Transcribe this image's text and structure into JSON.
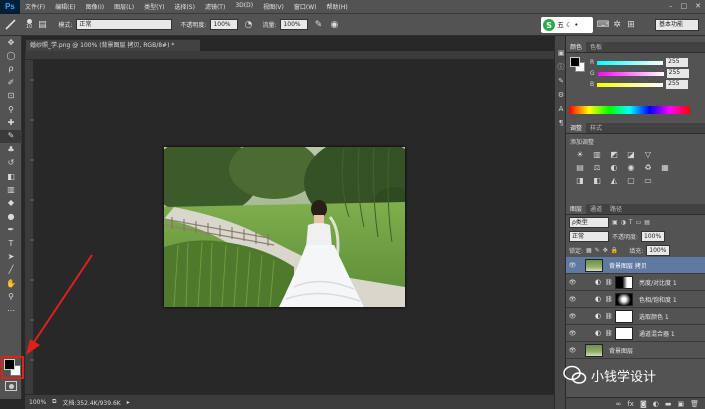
{
  "app": {
    "logo": "Ps"
  },
  "menu": [
    "文件(F)",
    "编辑(E)",
    "图像(I)",
    "图层(L)",
    "类型(Y)",
    "选择(S)",
    "滤镜(T)",
    "3D(D)",
    "视图(V)",
    "窗口(W)",
    "帮助(H)"
  ],
  "options_bar": {
    "brush_size": "10",
    "mode_label": "模式:",
    "mode_value": "正常",
    "opacity_label": "不透明度:",
    "opacity_value": "100%",
    "flow_label": "流量:",
    "flow_value": "100%",
    "brand_badge": "五",
    "workspace": "基本功能"
  },
  "document": {
    "tab_title": "婚纱照_学.png @ 100% (背景图层 拷贝, RGB/8#) *",
    "zoom": "100%",
    "doc_size": "文档:352.4K/939.6K"
  },
  "color_panel": {
    "tabs": [
      "颜色",
      "色板"
    ],
    "channels": [
      {
        "label": "R",
        "value": "255"
      },
      {
        "label": "G",
        "value": "255"
      },
      {
        "label": "B",
        "value": "255"
      }
    ]
  },
  "adjustments_panel": {
    "tabs": [
      "调整",
      "样式"
    ],
    "title": "添加调整"
  },
  "layers_panel": {
    "tabs": [
      "图层",
      "通道",
      "路径"
    ],
    "filter": "ρ类型",
    "blend_mode": "正常",
    "opacity_label": "不透明度:",
    "opacity_value": "100%",
    "lock_label": "锁定:",
    "fill_label": "填充:",
    "fill_value": "100%",
    "layers": [
      {
        "name": "背景图层 拷贝",
        "selected": true,
        "type": "photo"
      },
      {
        "name": "亮度/对比度 1",
        "selected": false,
        "type": "adjust"
      },
      {
        "name": "色相/饱和度 1",
        "selected": false,
        "type": "adjust"
      },
      {
        "name": "选取颜色 1",
        "selected": false,
        "type": "adjust"
      },
      {
        "name": "通道混合器 1",
        "selected": false,
        "type": "adjust"
      },
      {
        "name": "背景图层",
        "selected": false,
        "type": "photo"
      }
    ]
  },
  "watermark": {
    "text": "小钱学设计"
  },
  "colors": {
    "foreground": "#000000",
    "background": "#ffffff",
    "annotation_arrow": "#e0201c",
    "selected_layer": "#5f7aa0"
  },
  "icons": {
    "wechat": "wechat-icon"
  }
}
